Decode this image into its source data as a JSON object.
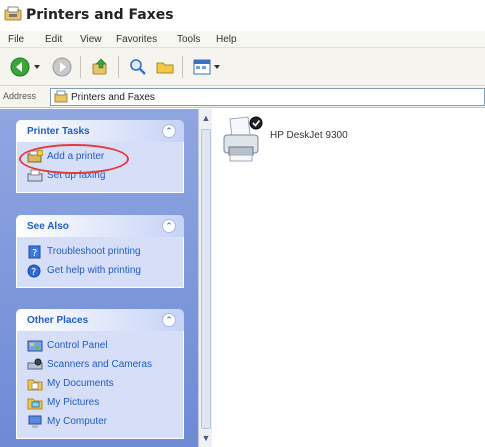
{
  "window": {
    "title": "Printers and Faxes"
  },
  "menu": [
    "File",
    "Edit",
    "View",
    "Favorites",
    "Tools",
    "Help"
  ],
  "toolbar": {
    "icons": [
      "back-icon",
      "forward-icon",
      "up-folder-icon",
      "search-icon",
      "folders-icon",
      "views-icon"
    ]
  },
  "address": {
    "label": "Address",
    "value": "Printers and Faxes"
  },
  "panels": {
    "printer_tasks": {
      "title": "Printer Tasks",
      "items": [
        {
          "label": "Add a printer",
          "icon": "add-printer-icon"
        },
        {
          "label": "Set up faxing",
          "icon": "fax-icon"
        }
      ]
    },
    "see_also": {
      "title": "See Also",
      "items": [
        {
          "label": "Troubleshoot printing",
          "icon": "troubleshoot-icon"
        },
        {
          "label": "Get help with printing",
          "icon": "help-icon"
        }
      ]
    },
    "other_places": {
      "title": "Other Places",
      "items": [
        {
          "label": "Control Panel",
          "icon": "control-panel-icon"
        },
        {
          "label": "Scanners and Cameras",
          "icon": "scanner-icon"
        },
        {
          "label": "My Documents",
          "icon": "documents-folder-icon"
        },
        {
          "label": "My Pictures",
          "icon": "pictures-folder-icon"
        },
        {
          "label": "My Computer",
          "icon": "computer-icon"
        }
      ]
    }
  },
  "content": {
    "printers": [
      {
        "label": "HP DeskJet 9300",
        "default": true
      }
    ]
  },
  "colors": {
    "task_link": "#215dc6",
    "pane_gradient_top": "#8fa6e0",
    "highlight_ring": "#e53a3a"
  }
}
